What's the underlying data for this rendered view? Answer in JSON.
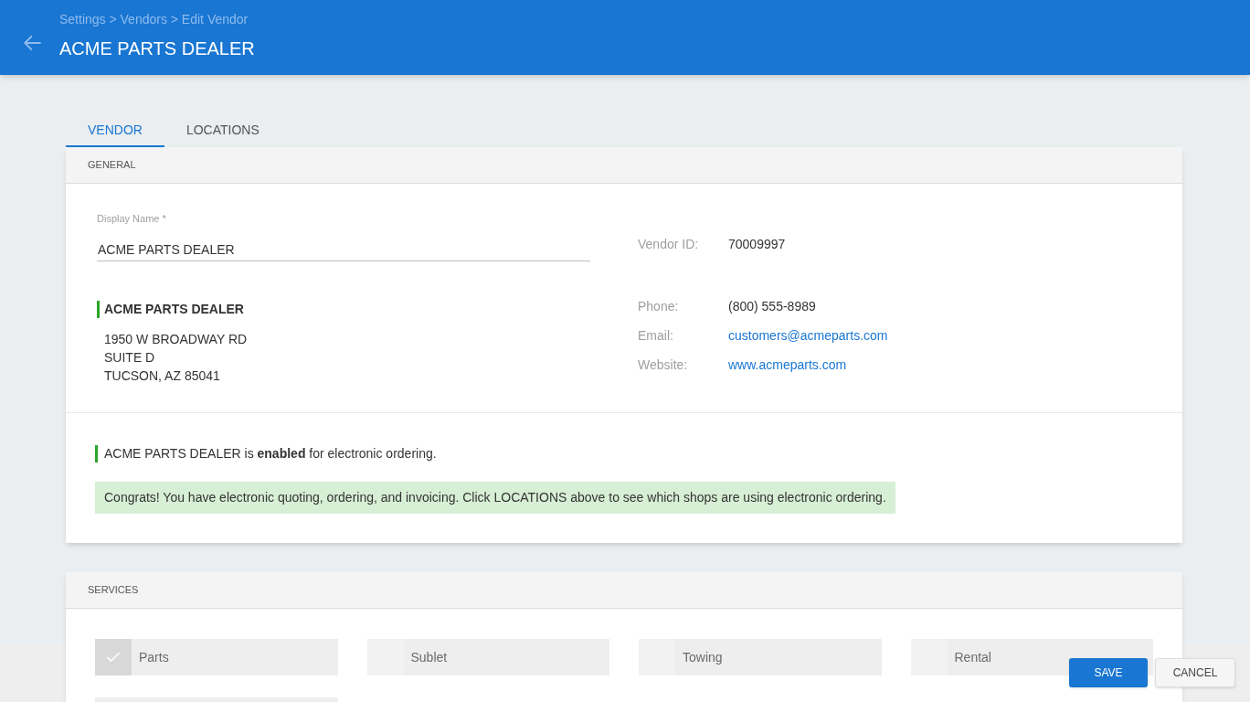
{
  "header": {
    "breadcrumb": "Settings > Vendors > Edit Vendor",
    "title": "ACME PARTS DEALER"
  },
  "tabs": [
    {
      "label": "VENDOR",
      "selected": true
    },
    {
      "label": "LOCATIONS",
      "selected": false
    }
  ],
  "general": {
    "heading": "GENERAL",
    "display_name": {
      "label": "Display Name *",
      "value": "ACME PARTS DEALER"
    },
    "address": {
      "name": "ACME PARTS DEALER",
      "lines": [
        "1950 W BROADWAY RD",
        "SUITE D",
        "TUCSON, AZ 85041"
      ]
    },
    "details": [
      {
        "label": "Vendor ID:",
        "value": "70009997",
        "kind": "text"
      },
      {
        "label": "Phone:",
        "value": "(800) 555-8989",
        "kind": "text"
      },
      {
        "label": "Email:",
        "value": "customers@acmeparts.com",
        "kind": "link"
      },
      {
        "label": "Website:",
        "value": "www.acmeparts.com",
        "kind": "link"
      }
    ],
    "status": "ACME PARTS DEALER is **enabled** for electronic ordering.",
    "notice": "Congrats! You have electronic quoting, ordering, and invoicing. Click LOCATIONS above to see which shops are using electronic ordering."
  },
  "services": {
    "heading": "SERVICES",
    "items": [
      {
        "label": "Parts",
        "checked": true
      },
      {
        "label": "Sublet",
        "checked": false
      },
      {
        "label": "Towing",
        "checked": false
      },
      {
        "label": "Rental",
        "checked": false
      }
    ]
  },
  "buttons": [
    {
      "label": "SAVE",
      "kind": "primary"
    },
    {
      "label": "CANCEL",
      "kind": "secondary"
    }
  ]
}
